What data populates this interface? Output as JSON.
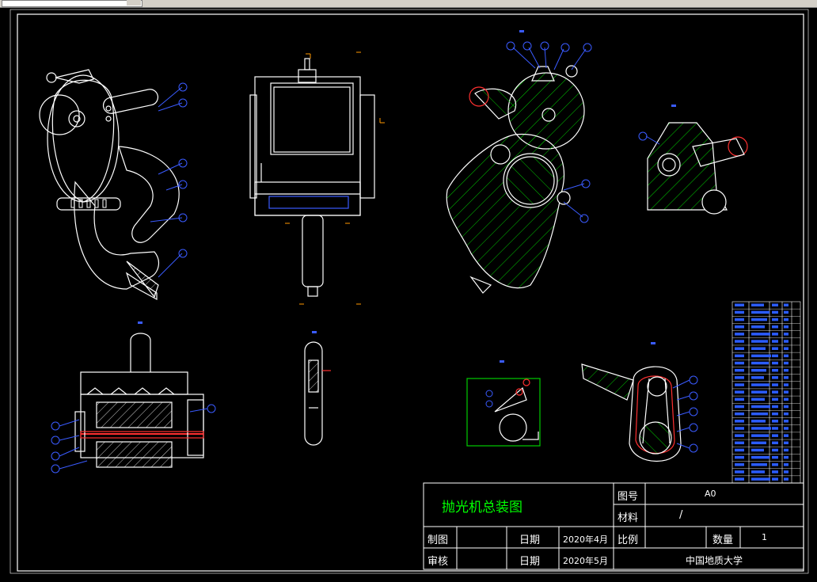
{
  "drawing": {
    "title_label": "抛光机总装图",
    "drawing_no_label": "图号",
    "drawing_no_value": "A0",
    "material_label": "材料",
    "material_value": "/",
    "scale_label": "比例",
    "quantity_label": "数量",
    "quantity_value": "1",
    "drawn_by_label": "制图",
    "reviewed_by_label": "审核",
    "date_label_1": "日期",
    "date_value_1": "2020年4月",
    "date_label_2": "日期",
    "date_value_2": "2020年5月",
    "organization": "中国地质大学"
  },
  "colors": {
    "background": "#000000",
    "outline": "#ffffff",
    "hatch": "#00cc00",
    "balloon": "#3a5bff",
    "centerline": "#ff3030",
    "dimension": "#ff9900",
    "titleblock_line": "#ffffff",
    "title_text": "#00ff00"
  }
}
